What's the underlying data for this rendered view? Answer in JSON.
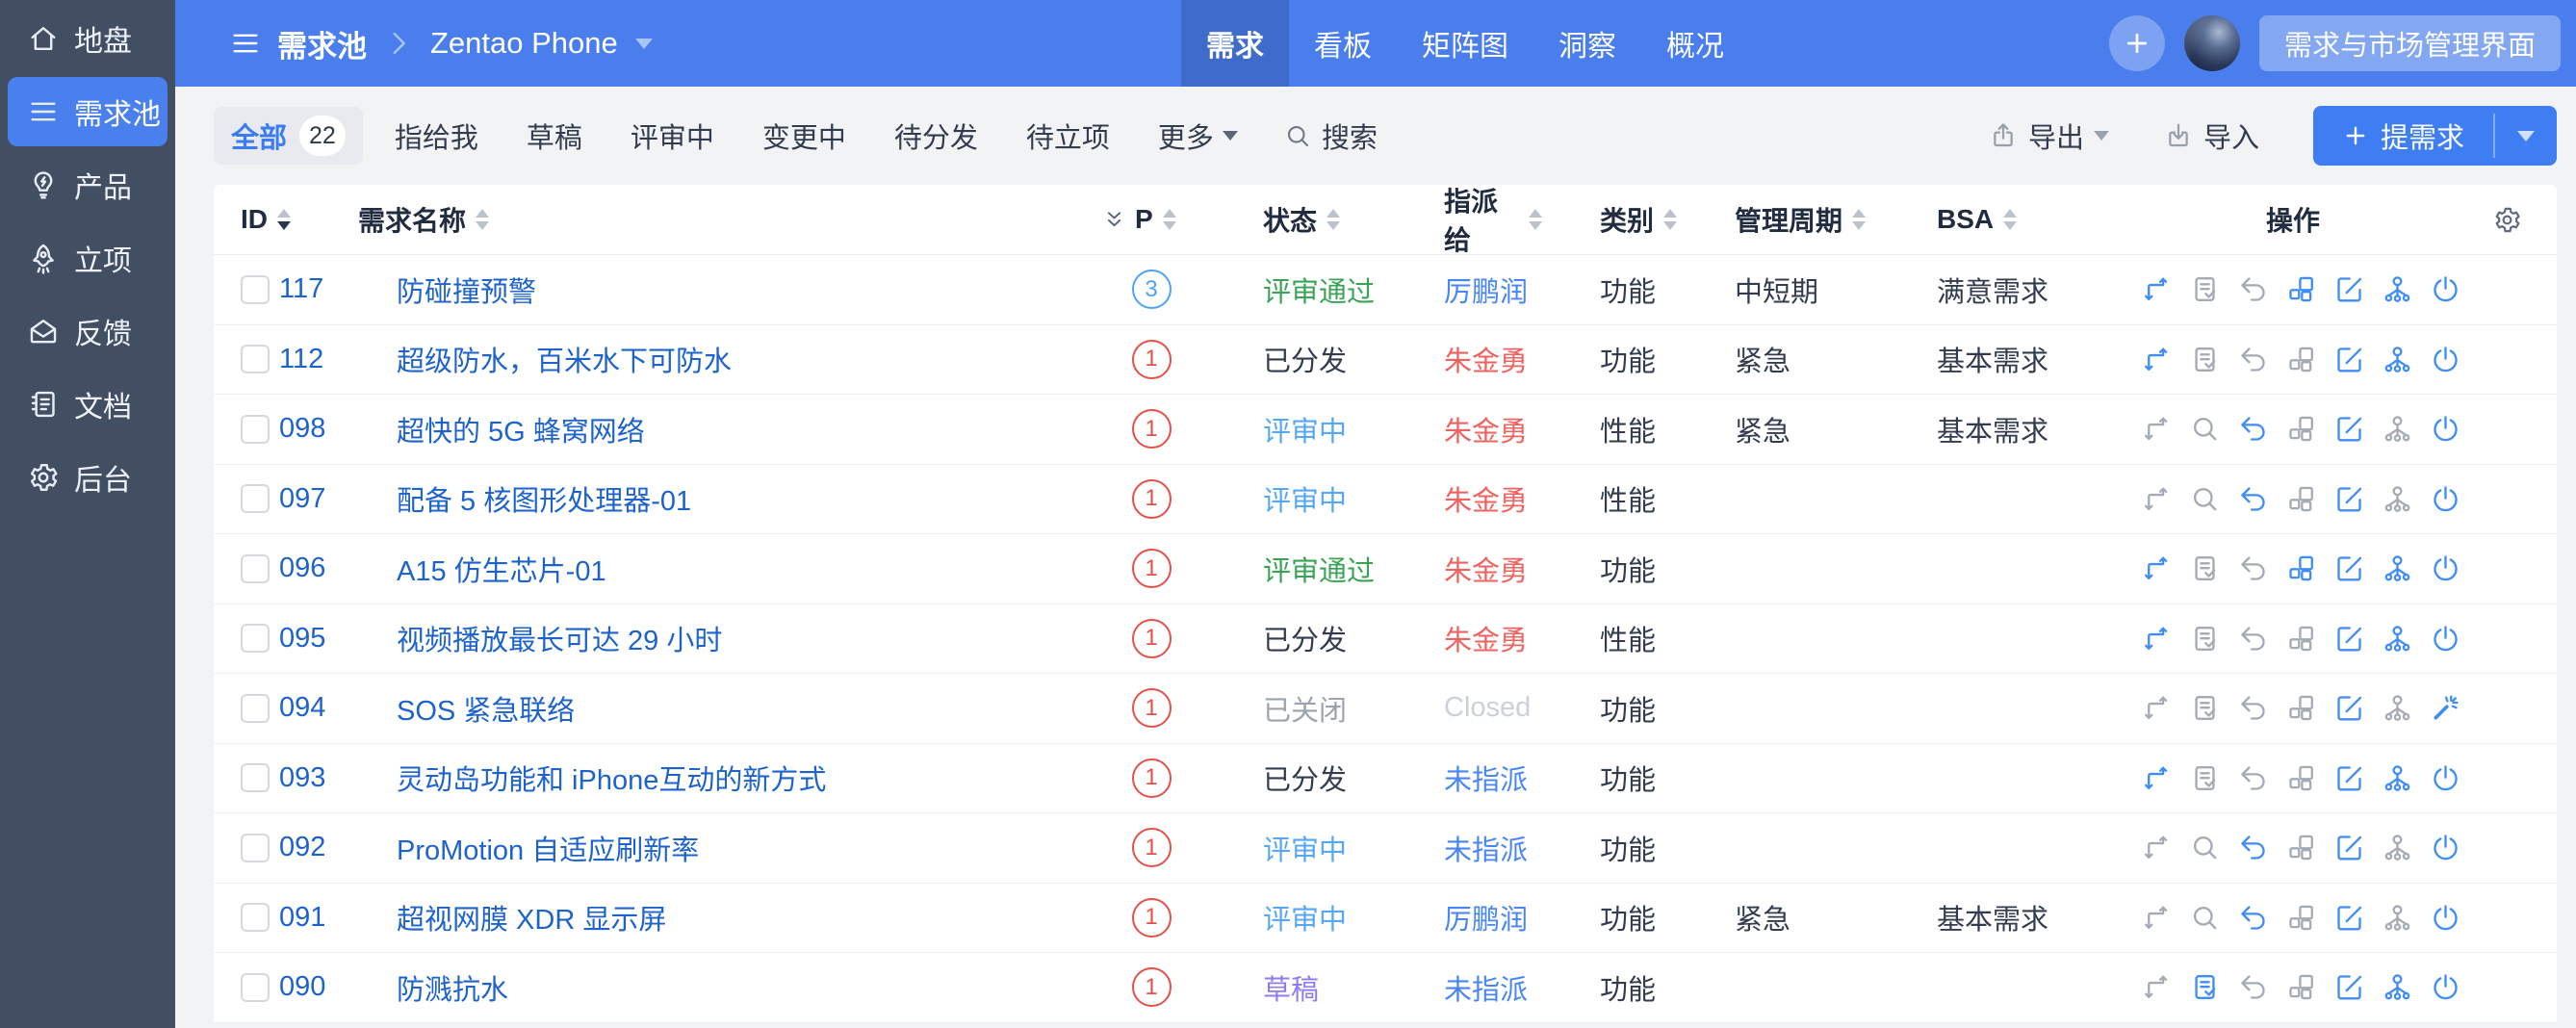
{
  "sidebar": {
    "items": [
      {
        "icon": "home",
        "label": "地盘",
        "active": false
      },
      {
        "icon": "list",
        "label": "需求池",
        "active": true
      },
      {
        "icon": "bulb",
        "label": "产品",
        "active": false
      },
      {
        "icon": "rocket",
        "label": "立项",
        "active": false
      },
      {
        "icon": "feedback",
        "label": "反馈",
        "active": false
      },
      {
        "icon": "doc",
        "label": "文档",
        "active": false
      },
      {
        "icon": "gear",
        "label": "后台",
        "active": false
      }
    ]
  },
  "topbar": {
    "breadcrumb": {
      "module": "需求池",
      "project": "Zentao Phone"
    },
    "tabs": [
      {
        "label": "需求",
        "active": true
      },
      {
        "label": "看板",
        "active": false
      },
      {
        "label": "矩阵图",
        "active": false
      },
      {
        "label": "洞察",
        "active": false
      },
      {
        "label": "概况",
        "active": false
      }
    ],
    "right_button": "需求与市场管理界面"
  },
  "toolbar": {
    "filters": [
      {
        "label": "全部",
        "count": "22",
        "active": true
      },
      {
        "label": "指给我"
      },
      {
        "label": "草稿"
      },
      {
        "label": "评审中"
      },
      {
        "label": "变更中"
      },
      {
        "label": "待分发"
      },
      {
        "label": "待立项"
      },
      {
        "label": "更多",
        "dropdown": true
      }
    ],
    "search_label": "搜索",
    "export_label": "导出",
    "import_label": "导入",
    "submit_label": "提需求"
  },
  "table": {
    "columns": [
      {
        "key": "id",
        "label": "ID",
        "sortable": true,
        "sorted": "desc"
      },
      {
        "key": "title",
        "label": "需求名称",
        "sortable": true
      },
      {
        "key": "p",
        "label": "P",
        "sortable": true,
        "collapse_icon": true
      },
      {
        "key": "status",
        "label": "状态",
        "sortable": true
      },
      {
        "key": "assignee",
        "label": "指派给",
        "sortable": true
      },
      {
        "key": "category",
        "label": "类别",
        "sortable": true
      },
      {
        "key": "period",
        "label": "管理周期",
        "sortable": true
      },
      {
        "key": "bsa",
        "label": "BSA",
        "sortable": true
      },
      {
        "key": "actions",
        "label": "操作",
        "sortable": false
      }
    ],
    "rows": [
      {
        "id": "117",
        "title": "防碰撞预警",
        "p": "3",
        "p_type": "blue",
        "status": "评审通过",
        "status_type": "passed",
        "assignee": "厉鹏润",
        "assignee_type": "link",
        "category": "功能",
        "period": "中短期",
        "bsa": "满意需求",
        "actions": [
          {
            "name": "transfer",
            "enabled": true
          },
          {
            "name": "review",
            "enabled": false
          },
          {
            "name": "withdraw",
            "enabled": false
          },
          {
            "name": "subdivide",
            "enabled": true
          },
          {
            "name": "edit",
            "enabled": true
          },
          {
            "name": "assign",
            "enabled": true
          },
          {
            "name": "close",
            "enabled": true
          }
        ]
      },
      {
        "id": "112",
        "title": "超级防水，百米水下可防水",
        "p": "1",
        "p_type": "red",
        "status": "已分发",
        "status_type": "distributed",
        "assignee": "朱金勇",
        "assignee_type": "danger",
        "category": "功能",
        "period": "紧急",
        "bsa": "基本需求",
        "actions": [
          {
            "name": "transfer",
            "enabled": true
          },
          {
            "name": "review",
            "enabled": false
          },
          {
            "name": "withdraw",
            "enabled": false
          },
          {
            "name": "subdivide",
            "enabled": false
          },
          {
            "name": "edit",
            "enabled": true
          },
          {
            "name": "assign",
            "enabled": true
          },
          {
            "name": "close",
            "enabled": true
          }
        ]
      },
      {
        "id": "098",
        "title": "超快的 5G 蜂窝网络",
        "p": "1",
        "p_type": "red",
        "status": "评审中",
        "status_type": "reviewing",
        "assignee": "朱金勇",
        "assignee_type": "danger",
        "category": "性能",
        "period": "紧急",
        "bsa": "基本需求",
        "actions": [
          {
            "name": "transfer",
            "enabled": false
          },
          {
            "name": "view-review",
            "enabled": false
          },
          {
            "name": "withdraw",
            "enabled": true
          },
          {
            "name": "subdivide",
            "enabled": false
          },
          {
            "name": "edit",
            "enabled": true
          },
          {
            "name": "assign",
            "enabled": false
          },
          {
            "name": "close",
            "enabled": true
          }
        ]
      },
      {
        "id": "097",
        "title": "配备 5 核图形处理器-01",
        "p": "1",
        "p_type": "red",
        "status": "评审中",
        "status_type": "reviewing",
        "assignee": "朱金勇",
        "assignee_type": "danger",
        "category": "性能",
        "period": "",
        "bsa": "",
        "actions": [
          {
            "name": "transfer",
            "enabled": false
          },
          {
            "name": "view-review",
            "enabled": false
          },
          {
            "name": "withdraw",
            "enabled": true
          },
          {
            "name": "subdivide",
            "enabled": false
          },
          {
            "name": "edit",
            "enabled": true
          },
          {
            "name": "assign",
            "enabled": false
          },
          {
            "name": "close",
            "enabled": true
          }
        ]
      },
      {
        "id": "096",
        "title": "A15 仿生芯片-01",
        "p": "1",
        "p_type": "red",
        "status": "评审通过",
        "status_type": "passed",
        "assignee": "朱金勇",
        "assignee_type": "danger",
        "category": "功能",
        "period": "",
        "bsa": "",
        "actions": [
          {
            "name": "transfer",
            "enabled": true
          },
          {
            "name": "review",
            "enabled": false
          },
          {
            "name": "withdraw",
            "enabled": false
          },
          {
            "name": "subdivide",
            "enabled": true
          },
          {
            "name": "edit",
            "enabled": true
          },
          {
            "name": "assign",
            "enabled": true
          },
          {
            "name": "close",
            "enabled": true
          }
        ]
      },
      {
        "id": "095",
        "title": "视频播放最长可达 29 小时",
        "p": "1",
        "p_type": "red",
        "status": "已分发",
        "status_type": "distributed",
        "assignee": "朱金勇",
        "assignee_type": "danger",
        "category": "性能",
        "period": "",
        "bsa": "",
        "actions": [
          {
            "name": "transfer",
            "enabled": true
          },
          {
            "name": "review",
            "enabled": false
          },
          {
            "name": "withdraw",
            "enabled": false
          },
          {
            "name": "subdivide",
            "enabled": false
          },
          {
            "name": "edit",
            "enabled": true
          },
          {
            "name": "assign",
            "enabled": true
          },
          {
            "name": "close",
            "enabled": true
          }
        ]
      },
      {
        "id": "094",
        "title": "SOS 紧急联络",
        "p": "1",
        "p_type": "red",
        "status": "已关闭",
        "status_type": "closed",
        "assignee": "Closed",
        "assignee_type": "muted",
        "category": "功能",
        "period": "",
        "bsa": "",
        "actions": [
          {
            "name": "transfer",
            "enabled": false
          },
          {
            "name": "review",
            "enabled": false
          },
          {
            "name": "withdraw",
            "enabled": false
          },
          {
            "name": "subdivide",
            "enabled": false
          },
          {
            "name": "edit",
            "enabled": true
          },
          {
            "name": "assign",
            "enabled": false
          },
          {
            "name": "activate",
            "enabled": true
          }
        ]
      },
      {
        "id": "093",
        "title": "灵动岛功能和 iPhone互动的新方式",
        "p": "1",
        "p_type": "red",
        "status": "已分发",
        "status_type": "distributed",
        "assignee": "未指派",
        "assignee_type": "link",
        "category": "功能",
        "period": "",
        "bsa": "",
        "actions": [
          {
            "name": "transfer",
            "enabled": true
          },
          {
            "name": "review",
            "enabled": false
          },
          {
            "name": "withdraw",
            "enabled": false
          },
          {
            "name": "subdivide",
            "enabled": false
          },
          {
            "name": "edit",
            "enabled": true
          },
          {
            "name": "assign",
            "enabled": true
          },
          {
            "name": "close",
            "enabled": true
          }
        ]
      },
      {
        "id": "092",
        "title": "ProMotion 自适应刷新率",
        "p": "1",
        "p_type": "red",
        "status": "评审中",
        "status_type": "reviewing",
        "assignee": "未指派",
        "assignee_type": "link",
        "category": "功能",
        "period": "",
        "bsa": "",
        "actions": [
          {
            "name": "transfer",
            "enabled": false
          },
          {
            "name": "view-review",
            "enabled": false
          },
          {
            "name": "withdraw",
            "enabled": true
          },
          {
            "name": "subdivide",
            "enabled": false
          },
          {
            "name": "edit",
            "enabled": true
          },
          {
            "name": "assign",
            "enabled": false
          },
          {
            "name": "close",
            "enabled": true
          }
        ]
      },
      {
        "id": "091",
        "title": "超视网膜 XDR 显示屏",
        "p": "1",
        "p_type": "red",
        "status": "评审中",
        "status_type": "reviewing",
        "assignee": "厉鹏润",
        "assignee_type": "link",
        "category": "功能",
        "period": "紧急",
        "bsa": "基本需求",
        "actions": [
          {
            "name": "transfer",
            "enabled": false
          },
          {
            "name": "view-review",
            "enabled": false
          },
          {
            "name": "withdraw",
            "enabled": true
          },
          {
            "name": "subdivide",
            "enabled": false
          },
          {
            "name": "edit",
            "enabled": true
          },
          {
            "name": "assign",
            "enabled": false
          },
          {
            "name": "close",
            "enabled": true
          }
        ]
      },
      {
        "id": "090",
        "title": "防溅抗水",
        "p": "1",
        "p_type": "red",
        "status": "草稿",
        "status_type": "draft",
        "assignee": "未指派",
        "assignee_type": "link",
        "category": "功能",
        "period": "",
        "bsa": "",
        "actions": [
          {
            "name": "transfer",
            "enabled": false
          },
          {
            "name": "review",
            "enabled": true
          },
          {
            "name": "withdraw",
            "enabled": false
          },
          {
            "name": "subdivide",
            "enabled": false
          },
          {
            "name": "edit",
            "enabled": true
          },
          {
            "name": "assign",
            "enabled": true
          },
          {
            "name": "close",
            "enabled": true
          }
        ]
      }
    ]
  },
  "colors": {
    "topbar": "#4a7eec",
    "sidebar": "#424f63",
    "primary": "#3f7ef2",
    "link": "#1e63cb",
    "status_passed": "#3ba355",
    "status_reviewing": "#56a7f8",
    "status_distributed": "#323c4e",
    "status_closed": "#9aa3ae",
    "status_draft": "#8f7cf0",
    "assignee_danger": "#ee6360",
    "action_enabled": "#3f8df5",
    "action_disabled": "#a4abb4"
  }
}
